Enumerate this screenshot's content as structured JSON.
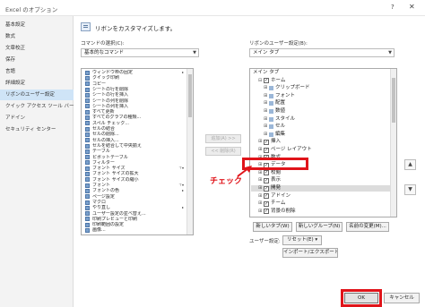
{
  "window": {
    "title": "Excel のオプション",
    "help": "?",
    "close": "✕"
  },
  "nav": {
    "items": [
      "基本設定",
      "数式",
      "文章校正",
      "保存",
      "言語",
      "詳細設定",
      "リボンのユーザー設定",
      "クイック アクセス ツール バー",
      "アドイン",
      "セキュリティ センター"
    ],
    "selected_index": 6
  },
  "main": {
    "title": "リボンをカスタマイズします。"
  },
  "left": {
    "label": "コマンドの選択(C):",
    "dropdown_value": "基本的なコマンド",
    "items": [
      {
        "label": "ウィンドウ枠の固定",
        "flag": "▸"
      },
      {
        "label": "クイック印刷",
        "flag": ""
      },
      {
        "label": "コピー",
        "flag": ""
      },
      {
        "label": "シートの行を削除",
        "flag": ""
      },
      {
        "label": "シートの行を挿入",
        "flag": ""
      },
      {
        "label": "シートの列を削除",
        "flag": ""
      },
      {
        "label": "シートの列を挿入",
        "flag": ""
      },
      {
        "label": "すべて更新",
        "flag": ""
      },
      {
        "label": "すべてのグラフの種類...",
        "flag": ""
      },
      {
        "label": "スペル チェック...",
        "flag": ""
      },
      {
        "label": "セルの結合",
        "flag": ""
      },
      {
        "label": "セルの削除...",
        "flag": ""
      },
      {
        "label": "セルの挿入...",
        "flag": ""
      },
      {
        "label": "セルを結合して中央揃え",
        "flag": ""
      },
      {
        "label": "テーブル",
        "flag": ""
      },
      {
        "label": "ピボットテーブル",
        "flag": ""
      },
      {
        "label": "フィルター",
        "flag": ""
      },
      {
        "label": "フォント サイズ",
        "flag": "⊤▾"
      },
      {
        "label": "フォント サイズの拡大",
        "flag": ""
      },
      {
        "label": "フォント サイズの縮小",
        "flag": ""
      },
      {
        "label": "フォント",
        "flag": "⊤▾"
      },
      {
        "label": "フォントの色",
        "flag": "▸"
      },
      {
        "label": "ページ設定",
        "flag": ""
      },
      {
        "label": "マクロ",
        "flag": ""
      },
      {
        "label": "やり直し",
        "flag": "▸"
      },
      {
        "label": "ユーザー設定の並べ替え...",
        "flag": ""
      },
      {
        "label": "印刷プレビューと印刷",
        "flag": ""
      },
      {
        "label": "印刷範囲の設定",
        "flag": ""
      },
      {
        "label": "画像...",
        "flag": ""
      }
    ]
  },
  "middle": {
    "add_label": "追加(A) >>",
    "remove_label": "<< 削除(R)"
  },
  "right": {
    "label": "リボンのユーザー設定(B):",
    "dropdown_value": "メイン タブ",
    "items": [
      {
        "label": "メイン タブ",
        "exp": "",
        "cb": "",
        "group": false,
        "indent": 0
      },
      {
        "label": "ホーム",
        "exp": "⊟",
        "cb": "✓",
        "group": false,
        "indent": 1
      },
      {
        "label": "クリップボード",
        "exp": "⊞",
        "cb": "",
        "group": true,
        "indent": 2
      },
      {
        "label": "フォント",
        "exp": "⊞",
        "cb": "",
        "group": true,
        "indent": 2
      },
      {
        "label": "配置",
        "exp": "⊞",
        "cb": "",
        "group": true,
        "indent": 2
      },
      {
        "label": "数値",
        "exp": "⊞",
        "cb": "",
        "group": true,
        "indent": 2
      },
      {
        "label": "スタイル",
        "exp": "⊞",
        "cb": "",
        "group": true,
        "indent": 2
      },
      {
        "label": "セル",
        "exp": "⊞",
        "cb": "",
        "group": true,
        "indent": 2
      },
      {
        "label": "編集",
        "exp": "⊞",
        "cb": "",
        "group": true,
        "indent": 2
      },
      {
        "label": "挿入",
        "exp": "⊞",
        "cb": "✓",
        "group": false,
        "indent": 1
      },
      {
        "label": "ページ レイアウト",
        "exp": "⊞",
        "cb": "✓",
        "group": false,
        "indent": 1
      },
      {
        "label": "数式",
        "exp": "⊞",
        "cb": "✓",
        "group": false,
        "indent": 1
      },
      {
        "label": "データ",
        "exp": "⊞",
        "cb": "✓",
        "group": false,
        "indent": 1
      },
      {
        "label": "校閲",
        "exp": "⊞",
        "cb": "✓",
        "group": false,
        "indent": 1
      },
      {
        "label": "表示",
        "exp": "⊞",
        "cb": "✓",
        "group": false,
        "indent": 1
      },
      {
        "label": "開発",
        "exp": "⊞",
        "cb": "✓",
        "group": false,
        "indent": 1
      },
      {
        "label": "アドイン",
        "exp": "⊞",
        "cb": "✓",
        "group": false,
        "indent": 1
      },
      {
        "label": "チーム",
        "exp": "⊞",
        "cb": "✓",
        "group": false,
        "indent": 1
      },
      {
        "label": "背景の削除",
        "exp": "⊞",
        "cb": "✓",
        "group": false,
        "indent": 1
      }
    ],
    "selected_index": 15,
    "up": "▲",
    "down": "▼"
  },
  "bottom": {
    "new_tab": "新しいタブ(W)",
    "new_group": "新しいグループ(N)",
    "rename": "名前の変更(M)...",
    "custom_label": "ユーザー設定:",
    "reset": "リセット(E) ▾",
    "import_export": "インポート/エクスポート(P) ▾",
    "ok": "OK",
    "cancel": "キャンセル"
  },
  "annotation": {
    "text": "チェック",
    "color": "#e0141a"
  }
}
